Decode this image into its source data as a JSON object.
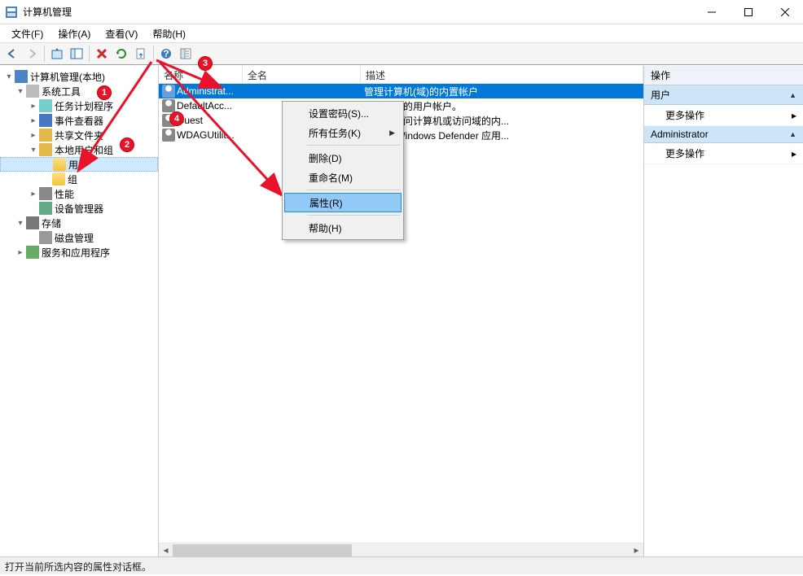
{
  "window": {
    "title": "计算机管理",
    "min_tooltip": "Minimize",
    "max_tooltip": "Maximize",
    "close_tooltip": "Close"
  },
  "menubar": {
    "file": "文件(F)",
    "action": "操作(A)",
    "view": "查看(V)",
    "help": "帮助(H)"
  },
  "tree": {
    "root": "计算机管理(本地)",
    "system_tools": "系统工具",
    "task_scheduler": "任务计划程序",
    "event_viewer": "事件查看器",
    "shared_folders": "共享文件夹",
    "local_users_groups": "本地用户和组",
    "users": "用户",
    "groups": "组",
    "performance": "性能",
    "device_manager": "设备管理器",
    "storage": "存储",
    "disk_management": "磁盘管理",
    "services_apps": "服务和应用程序"
  },
  "list": {
    "columns": {
      "name": "名称",
      "fullname": "全名",
      "desc": "描述"
    },
    "rows": [
      {
        "name": "Administrat...",
        "fullname": "",
        "desc": "管理计算机(域)的内置帐户",
        "selected": true,
        "disabled": false
      },
      {
        "name": "DefaultAcc...",
        "fullname": "",
        "desc": "系统管理的用户帐户。",
        "selected": false,
        "disabled": true
      },
      {
        "name": "Guest",
        "fullname": "",
        "desc": "供来宾访问计算机或访问域的内...",
        "selected": false,
        "disabled": true
      },
      {
        "name": "WDAGUtilit...",
        "fullname": "",
        "desc": "系统为 Windows Defender 应用...",
        "selected": false,
        "disabled": true
      }
    ]
  },
  "context_menu": {
    "set_password": "设置密码(S)...",
    "all_tasks": "所有任务(K)",
    "delete": "删除(D)",
    "rename": "重命名(M)",
    "properties": "属性(R)",
    "help": "帮助(H)"
  },
  "actions": {
    "title": "操作",
    "section_users": "用户",
    "more_actions": "更多操作",
    "section_admin": "Administrator"
  },
  "statusbar": {
    "text": "打开当前所选内容的属性对话框。"
  },
  "annotations": {
    "b1": "1",
    "b2": "2",
    "b3": "3",
    "b4": "4"
  }
}
